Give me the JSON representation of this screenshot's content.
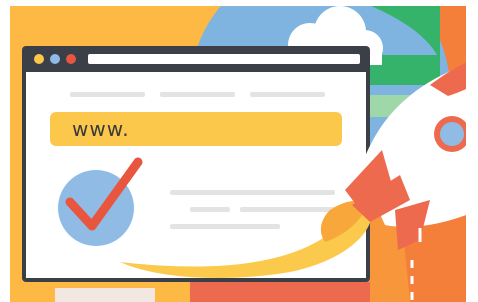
{
  "browser": {
    "url_text": "www.",
    "controls": [
      "yellow-dot",
      "blue-dot",
      "red-dot"
    ]
  },
  "icons": [
    "checkmark-icon",
    "rocket-icon",
    "cloud-icon",
    "planet-icon"
  ],
  "colors": {
    "background_orange": "#f8963c",
    "background_yellow": "#fdb944",
    "window_frame": "#3b3f47",
    "url_bar": "#fcc84b",
    "check_circle": "#8fbbe5",
    "check_mark": "#e8563f",
    "rocket_red": "#ee6a4f",
    "flame_yellow": "#fbc94c"
  }
}
